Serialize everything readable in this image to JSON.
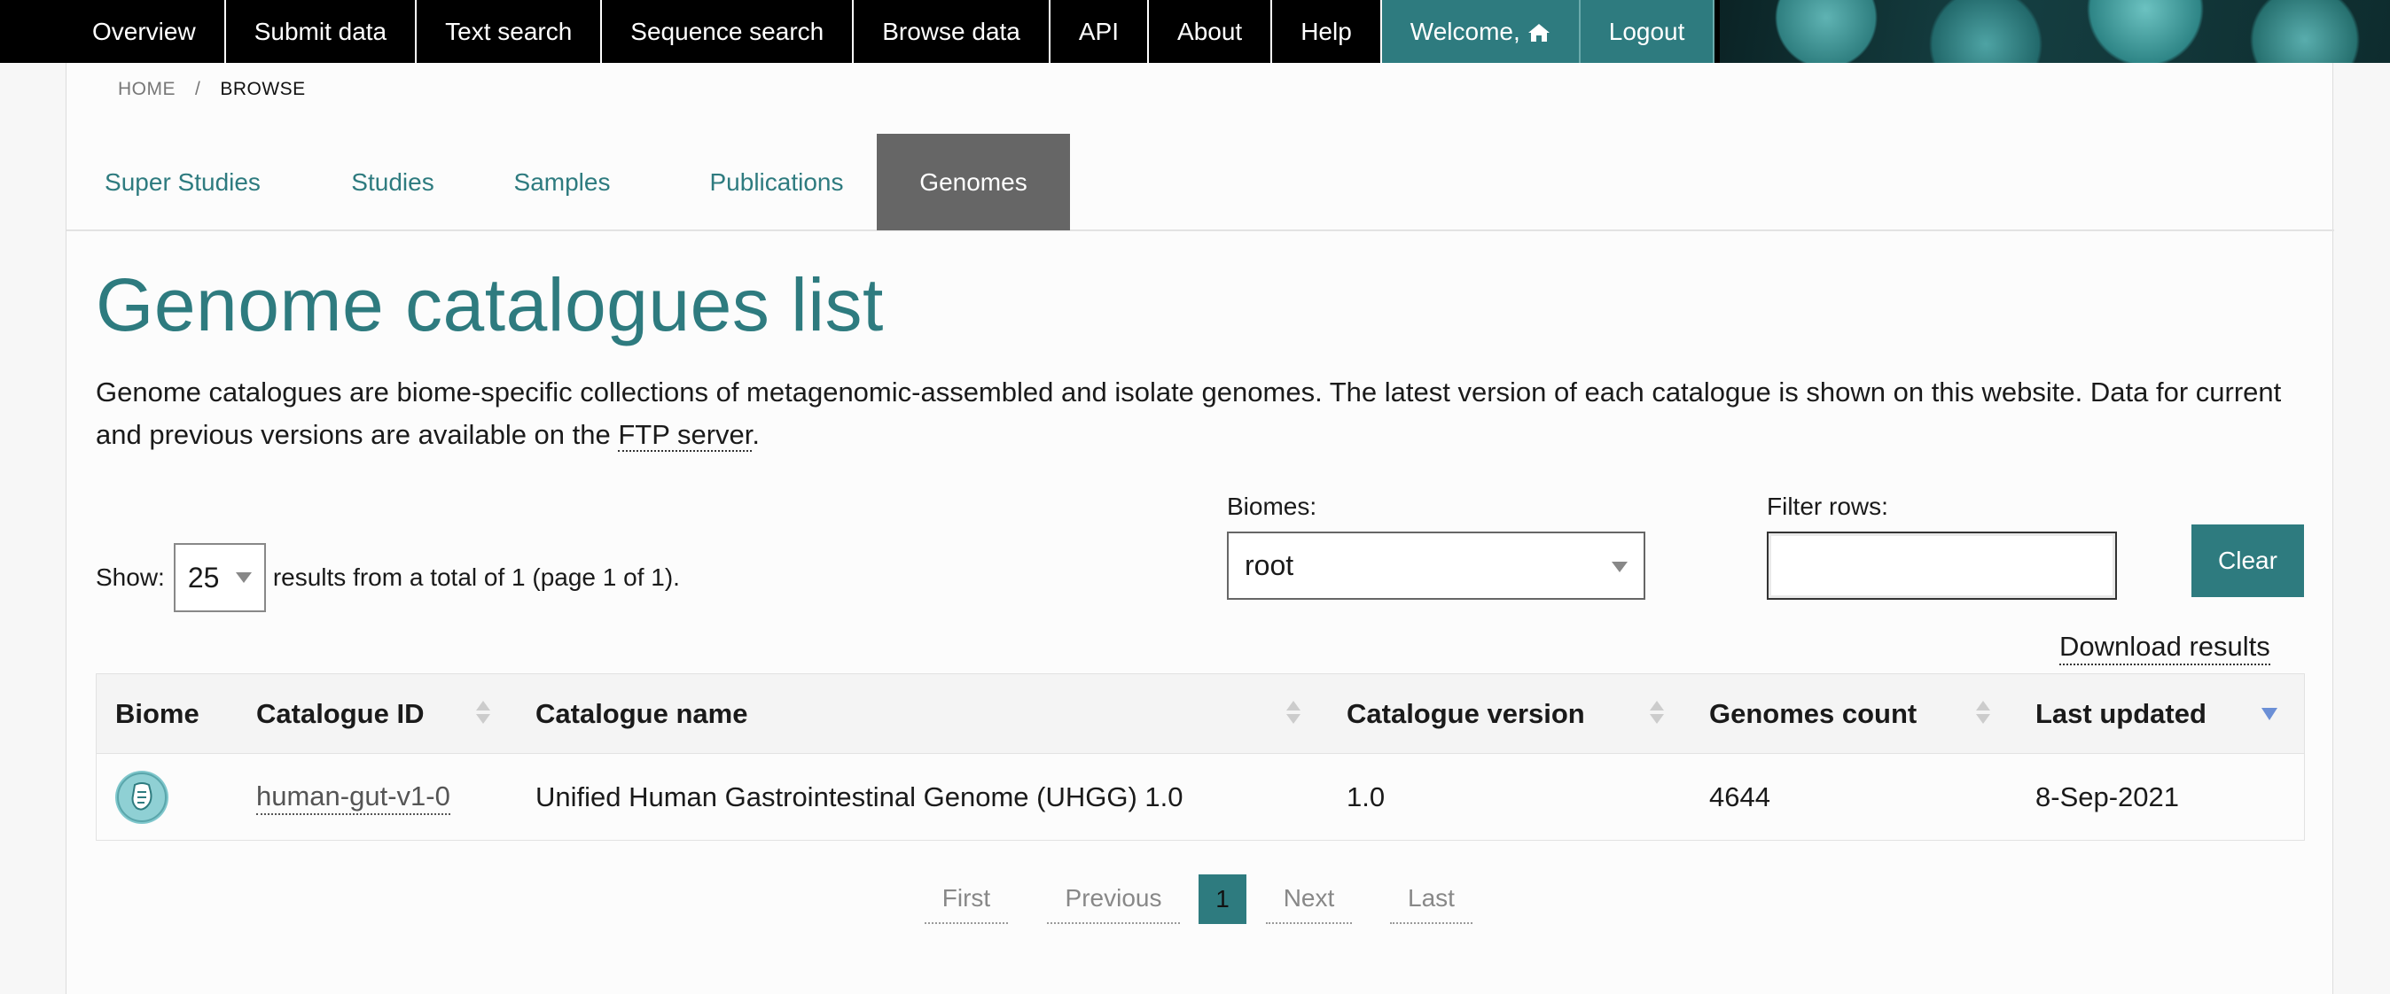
{
  "nav": {
    "items": [
      "Overview",
      "Submit data",
      "Text search",
      "Sequence search",
      "Browse data",
      "API",
      "About",
      "Help"
    ],
    "welcome": "Welcome,",
    "logout": "Logout"
  },
  "breadcrumb": {
    "home": "HOME",
    "separator": "/",
    "current": "BROWSE"
  },
  "tabs": [
    "Super Studies",
    "Studies",
    "Samples",
    "Publications",
    "Genomes"
  ],
  "active_tab": "Genomes",
  "page": {
    "title": "Genome catalogues list",
    "intro_text": "Genome catalogues are biome-specific collections of metagenomic-assembled and isolate genomes. The latest version of each catalogue is shown on this website. Data for current and previous versions are available on the ",
    "intro_link": "FTP server",
    "intro_end": "."
  },
  "controls": {
    "show_label": "Show:",
    "page_size": "25",
    "results_text": "results from a total of 1 (page 1 of 1).",
    "biomes_label": "Biomes:",
    "biome_value": "root",
    "filter_label": "Filter rows:",
    "filter_value": "",
    "clear_label": "Clear",
    "download_label": "Download results"
  },
  "table": {
    "headers": [
      "Biome",
      "Catalogue ID",
      "Catalogue name",
      "Catalogue version",
      "Genomes count",
      "Last updated"
    ],
    "rows": [
      {
        "biome_icon": "human-digestive-icon",
        "catalogue_id": "human-gut-v1-0",
        "catalogue_name": "Unified Human Gastrointestinal Genome (UHGG) 1.0",
        "catalogue_version": "1.0",
        "genomes_count": "4644",
        "last_updated": "8-Sep-2021"
      }
    ]
  },
  "pagination": {
    "first": "First",
    "previous": "Previous",
    "current": "1",
    "next": "Next",
    "last": "Last"
  },
  "colors": {
    "accent": "#2e7b7f",
    "nav_bg": "#000000",
    "active_tab": "#666666"
  }
}
